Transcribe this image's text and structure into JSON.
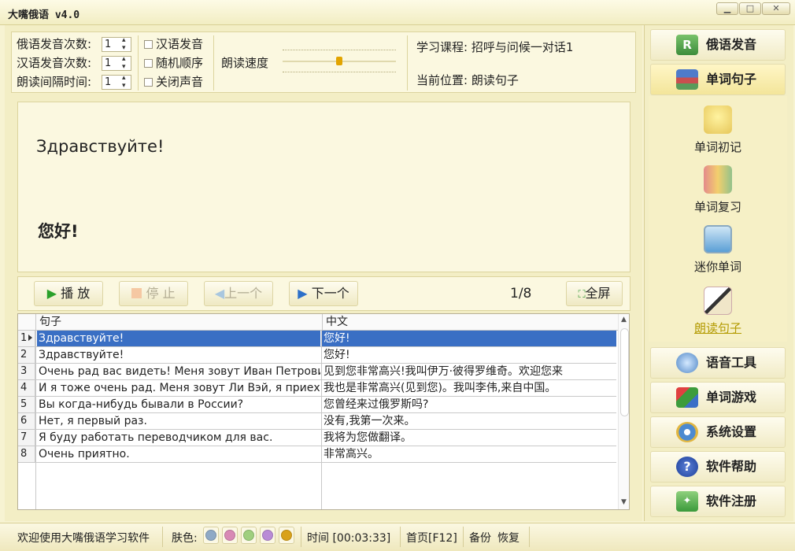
{
  "window": {
    "title": "大嘴俄语 v4.0"
  },
  "settings": {
    "ru_repeat_label": "俄语发音次数:",
    "ru_repeat_value": "1",
    "cn_repeat_label": "汉语发音次数:",
    "cn_repeat_value": "1",
    "interval_label": "朗读间隔时间:",
    "interval_value": "1",
    "checkbox_cn_audio": "汉语发音",
    "checkbox_random": "随机顺序",
    "checkbox_mute": "关闭声音",
    "speed_label": "朗读速度",
    "course_label": "学习课程:",
    "course_value": "招呼与问候一对话1",
    "position_label": "当前位置:",
    "position_value": "朗读句子"
  },
  "display": {
    "russian": "Здравствуйте!",
    "chinese": "您好!"
  },
  "controls": {
    "play": "播 放",
    "stop": "停 止",
    "prev": "上一个",
    "next": "下一个",
    "counter": "1/8",
    "fullscreen": "全屏"
  },
  "table": {
    "headers": [
      "句子",
      "中文"
    ],
    "rows": [
      {
        "n": "1",
        "ru": "Здравствуйте!",
        "cn": "您好!"
      },
      {
        "n": "2",
        "ru": "Здравствуйте!",
        "cn": "您好!"
      },
      {
        "n": "3",
        "ru": "Очень рад вас видеть! Меня зовут Иван Петрови",
        "cn": "见到您非常高兴!我叫伊万·彼得罗维奇。欢迎您来"
      },
      {
        "n": "4",
        "ru": "И я тоже очень рад. Меня зовут Ли Вэй, я приех",
        "cn": "我也是非常高兴(见到您)。我叫李伟,来自中国。"
      },
      {
        "n": "5",
        "ru": "Вы когда-нибудь бывали в России?",
        "cn": "您曾经来过俄罗斯吗?"
      },
      {
        "n": "6",
        "ru": "Нет, я первый раз.",
        "cn": "没有,我第一次来。"
      },
      {
        "n": "7",
        "ru": "Я буду работать переводчиком для вас.",
        "cn": "我将为您做翻译。"
      },
      {
        "n": "8",
        "ru": "Очень приятно.",
        "cn": "非常高兴。"
      }
    ],
    "selected_row": 1
  },
  "sidebar": {
    "ru_pronunciation": "俄语发音",
    "word_sentence": "单词句子",
    "sub_items": [
      "单词初记",
      "单词复习",
      "迷你单词",
      "朗读句子"
    ],
    "active_sub_item": "朗读句子",
    "voice_tools": "语音工具",
    "word_game": "单词游戏",
    "system_settings": "系统设置",
    "help": "软件帮助",
    "register": "软件注册"
  },
  "statusbar": {
    "welcome": "欢迎使用大嘴俄语学习软件",
    "skin_label": "肤色:",
    "skin_colors": [
      "#8fa9c6",
      "#d889b5",
      "#9fcf7e",
      "#b98bd6",
      "#d9a21b"
    ],
    "time_label": "时间 [00:03:33]",
    "home": "首页[F12]",
    "backup": "备份",
    "restore": "恢复"
  }
}
